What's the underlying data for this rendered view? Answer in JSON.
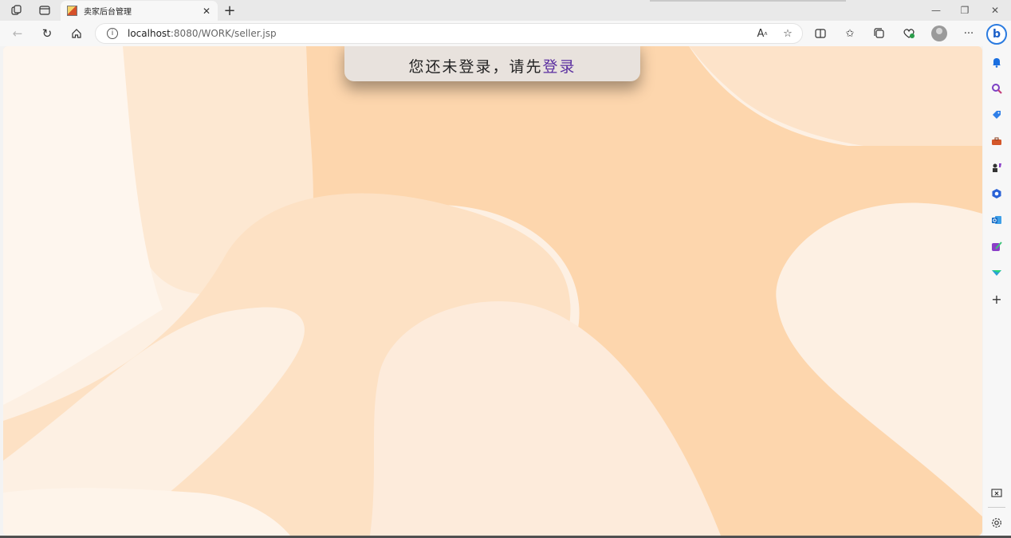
{
  "browser": {
    "tab": {
      "title": "卖家后台管理",
      "favicon": "html-file-icon"
    },
    "url": {
      "host": "localhost",
      "rest": ":8080/WORK/seller.jsp"
    },
    "colors": {
      "accent_link": "#5a2ea0",
      "bing": "#2a7be0"
    }
  },
  "page": {
    "notice_text": "您还未登录，请先",
    "login_link": "登录"
  },
  "sidebar": {
    "items": [
      {
        "icon": "bell-icon",
        "color": "#1a6fe0"
      },
      {
        "icon": "search-icon",
        "color": "#7b3fc4"
      },
      {
        "icon": "tag-icon",
        "color": "#2f7fe8"
      },
      {
        "icon": "toolbox-icon",
        "color": "#d4572a"
      },
      {
        "icon": "chess-icon",
        "color": "#6a3fc2"
      },
      {
        "icon": "office-icon",
        "color": "#2a62d6"
      },
      {
        "icon": "outlook-icon",
        "color": "#1469c4"
      },
      {
        "icon": "designer-icon",
        "color": "#8a3fc8"
      },
      {
        "icon": "send-icon",
        "color": "#2aa0d6"
      }
    ]
  }
}
